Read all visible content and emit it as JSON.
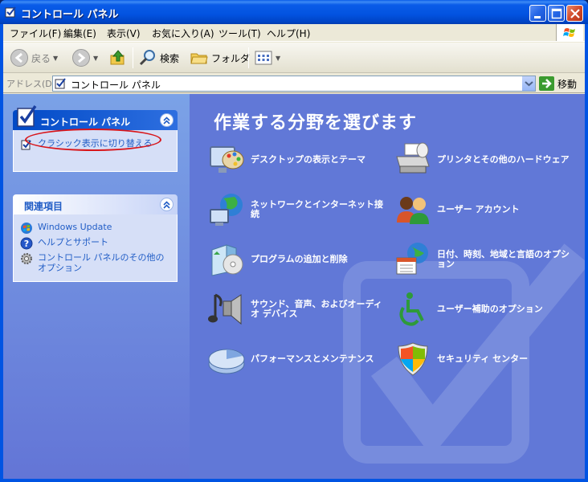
{
  "window": {
    "title": "コントロール パネル"
  },
  "menu": [
    "ファイル(F)",
    "編集(E)",
    "表示(V)",
    "お気に入り(A)",
    "ツール(T)",
    "ヘルプ(H)"
  ],
  "toolbar": {
    "back": "戻る",
    "search": "検索",
    "folders": "フォルダ"
  },
  "address": {
    "label": "アドレス(D)",
    "value": "コントロール パネル",
    "go": "移動"
  },
  "taskpane": {
    "cp_panel": {
      "title": "コントロール パネル",
      "link": "クラシック表示に切り替える"
    },
    "related": {
      "title": "関連項目",
      "links": [
        "Windows Update",
        "ヘルプとサポート",
        "コントロール パネルのその他のオプション"
      ]
    }
  },
  "main": {
    "heading": "作業する分野を選びます",
    "categories": [
      {
        "label": "デスクトップの表示とテーマ",
        "icon": "desktop-theme-icon"
      },
      {
        "label": "プリンタとその他のハードウェア",
        "icon": "printer-icon"
      },
      {
        "label": "ネットワークとインターネット接続",
        "icon": "network-icon"
      },
      {
        "label": "ユーザー アカウント",
        "icon": "user-accounts-icon"
      },
      {
        "label": "プログラムの追加と削除",
        "icon": "add-remove-programs-icon"
      },
      {
        "label": "日付、時刻、地域と言語のオプション",
        "icon": "date-time-region-icon"
      },
      {
        "label": "サウンド、音声、およびオーディオ デバイス",
        "icon": "sound-icon"
      },
      {
        "label": "ユーザー補助のオプション",
        "icon": "accessibility-icon"
      },
      {
        "label": "パフォーマンスとメンテナンス",
        "icon": "performance-icon"
      },
      {
        "label": "セキュリティ センター",
        "icon": "security-center-icon"
      }
    ]
  },
  "colors": {
    "title_bar": "#0054e3",
    "main_bg": "#6178d7",
    "taskpane_bg": "#7ba2e7",
    "link": "#215dc6",
    "highlight_oval": "#d8151a"
  }
}
